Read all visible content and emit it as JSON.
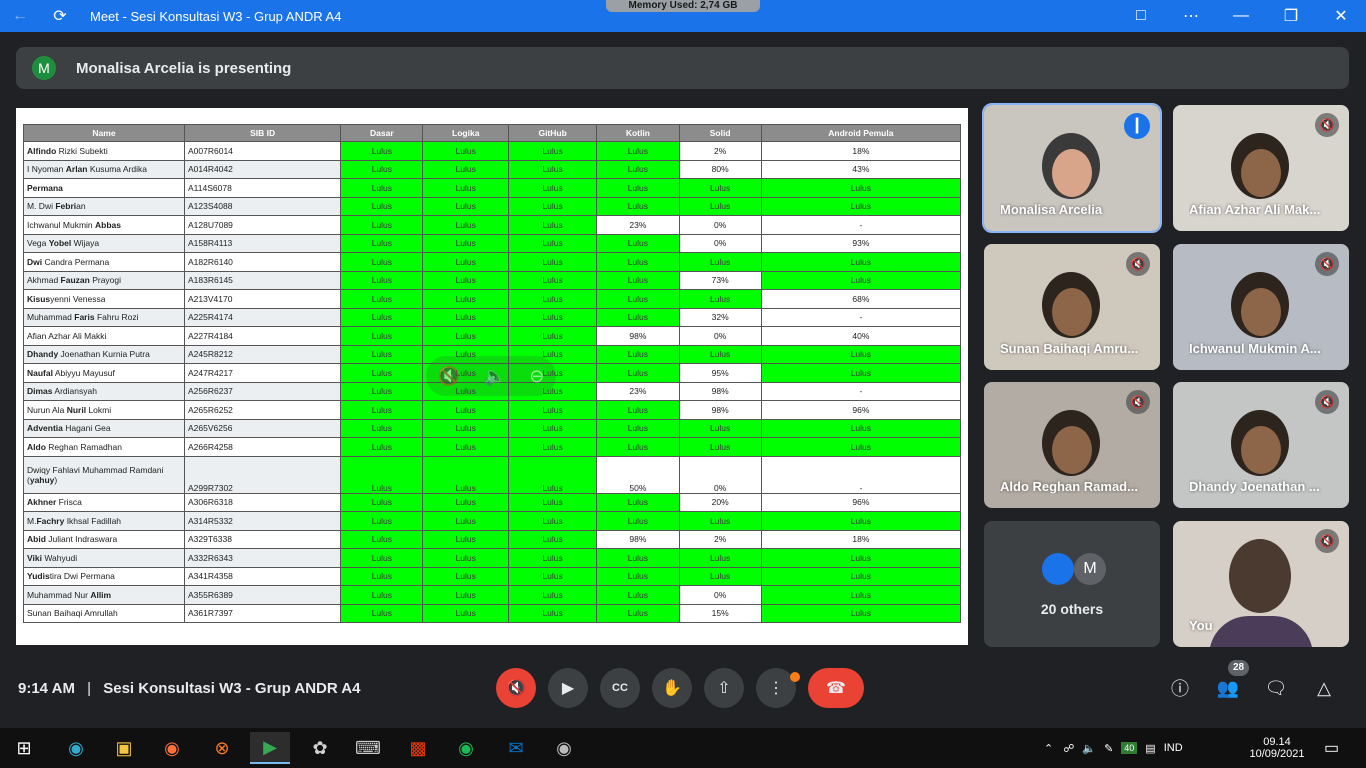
{
  "window": {
    "title": "Meet - Sesi Konsultasi W3 - Grup ANDR A4",
    "memory": "Memory Used: 2,74 GB"
  },
  "presenting": {
    "avatar_letter": "M",
    "text": "Monalisa Arcelia is presenting"
  },
  "table": {
    "headers": [
      "Name",
      "SIB ID",
      "Dasar",
      "Logika",
      "GitHub",
      "Kotlin",
      "Solid",
      "Android Pemula"
    ],
    "rows": [
      {
        "name_pre": "",
        "name_bold": "Alfindo",
        "name_post": " Rizki Subekti",
        "id": "A007R6014",
        "v": [
          "Lulus",
          "Lulus",
          "Lulus",
          "Lulus",
          "2%",
          "18%"
        ]
      },
      {
        "name_pre": "I Nyoman ",
        "name_bold": "Arlan",
        "name_post": " Kusuma Ardika",
        "id": "A014R4042",
        "v": [
          "Lulus",
          "Lulus",
          "Lulus",
          "Lulus",
          "80%",
          "43%"
        ]
      },
      {
        "name_pre": "",
        "name_bold": "Permana",
        "name_post": "",
        "id": "A114S6078",
        "v": [
          "Lulus",
          "Lulus",
          "Lulus",
          "Lulus",
          "Lulus",
          "Lulus"
        ]
      },
      {
        "name_pre": "M. Dwi ",
        "name_bold": "Febri",
        "name_post": "an",
        "id": "A123S4088",
        "v": [
          "Lulus",
          "Lulus",
          "Lulus",
          "Lulus",
          "Lulus",
          "Lulus"
        ]
      },
      {
        "name_pre": "Ichwanul Mukmin ",
        "name_bold": "Abbas",
        "name_post": "",
        "id": "A128U7089",
        "v": [
          "Lulus",
          "Lulus",
          "Lulus",
          "23%",
          "0%",
          "-"
        ]
      },
      {
        "name_pre": "Vega ",
        "name_bold": "Yobel",
        "name_post": " Wijaya",
        "id": "A158R4113",
        "v": [
          "Lulus",
          "Lulus",
          "Lulus",
          "Lulus",
          "0%",
          "93%"
        ]
      },
      {
        "name_pre": "",
        "name_bold": "Dwi",
        "name_post": " Candra Permana",
        "id": "A182R6140",
        "v": [
          "Lulus",
          "Lulus",
          "Lulus",
          "Lulus",
          "Lulus",
          "Lulus"
        ]
      },
      {
        "name_pre": "Akhmad ",
        "name_bold": "Fauzan",
        "name_post": " Prayogi",
        "id": "A183R6145",
        "v": [
          "Lulus",
          "Lulus",
          "Lulus",
          "Lulus",
          "73%",
          "Lulus"
        ]
      },
      {
        "name_pre": "",
        "name_bold": "Kisus",
        "name_post": "yenni Venessa",
        "id": "A213V4170",
        "v": [
          "Lulus",
          "Lulus",
          "Lulus",
          "Lulus",
          "Lulus",
          "68%"
        ]
      },
      {
        "name_pre": "Muhammad ",
        "name_bold": "Faris",
        "name_post": " Fahru Rozi",
        "id": "A225R4174",
        "v": [
          "Lulus",
          "Lulus",
          "Lulus",
          "Lulus",
          "32%",
          "-"
        ]
      },
      {
        "name_pre": "",
        "name_bold": "",
        "name_post": "Afian Azhar Ali Makki",
        "id": "A227R4184",
        "v": [
          "Lulus",
          "Lulus",
          "Lulus",
          "98%",
          "0%",
          "40%"
        ]
      },
      {
        "name_pre": "",
        "name_bold": "Dhandy",
        "name_post": " Joenathan Kurnia Putra",
        "id": "A245R8212",
        "v": [
          "Lulus",
          "Lulus",
          "Lulus",
          "Lulus",
          "Lulus",
          "Lulus"
        ]
      },
      {
        "name_pre": "",
        "name_bold": "Naufal",
        "name_post": " Abiyyu Mayusuf",
        "id": "A247R4217",
        "v": [
          "Lulus",
          "Lulus",
          "Lulus",
          "Lulus",
          "95%",
          "Lulus"
        ]
      },
      {
        "name_pre": "",
        "name_bold": "Dimas",
        "name_post": " Ardiansyah",
        "id": "A256R6237",
        "v": [
          "Lulus",
          "Lulus",
          "Lulus",
          "23%",
          "98%",
          "-"
        ]
      },
      {
        "name_pre": "Nurun Ala ",
        "name_bold": "Nuril",
        "name_post": " Lokmi",
        "id": "A265R6252",
        "v": [
          "Lulus",
          "Lulus",
          "Lulus",
          "Lulus",
          "98%",
          "96%"
        ]
      },
      {
        "name_pre": "",
        "name_bold": "Adventia",
        "name_post": " Hagani Gea",
        "id": "A265V6256",
        "v": [
          "Lulus",
          "Lulus",
          "Lulus",
          "Lulus",
          "Lulus",
          "Lulus"
        ]
      },
      {
        "name_pre": "",
        "name_bold": "Aldo",
        "name_post": " Reghan Ramadhan",
        "id": "A266R4258",
        "v": [
          "Lulus",
          "Lulus",
          "Lulus",
          "Lulus",
          "Lulus",
          "Lulus"
        ]
      },
      {
        "name_pre": "Dwiqy Fahlavi Muhammad Ramdani (",
        "name_bold": "yahuy",
        "name_post": ")",
        "id": "A299R7302",
        "v": [
          "Lulus",
          "Lulus",
          "Lulus",
          "50%",
          "0%",
          "-"
        ],
        "tall": true
      },
      {
        "name_pre": "",
        "name_bold": "Akhner",
        "name_post": " Frisca",
        "id": "A306R6318",
        "v": [
          "Lulus",
          "Lulus",
          "Lulus",
          "Lulus",
          "20%",
          "96%"
        ]
      },
      {
        "name_pre": "M.",
        "name_bold": "Fachry",
        "name_post": " Ikhsal Fadillah",
        "id": "A314R5332",
        "v": [
          "Lulus",
          "Lulus",
          "Lulus",
          "Lulus",
          "Lulus",
          "Lulus"
        ]
      },
      {
        "name_pre": "",
        "name_bold": "Abid",
        "name_post": " Juliant Indraswara",
        "id": "A329T6338",
        "v": [
          "Lulus",
          "Lulus",
          "Lulus",
          "98%",
          "2%",
          "18%"
        ]
      },
      {
        "name_pre": "",
        "name_bold": "Viki",
        "name_post": " Wahyudi",
        "id": "A332R6343",
        "v": [
          "Lulus",
          "Lulus",
          "Lulus",
          "Lulus",
          "Lulus",
          "Lulus"
        ]
      },
      {
        "name_pre": "",
        "name_bold": "Yudis",
        "name_post": "tira Dwi Permana",
        "id": "A341R4358",
        "v": [
          "Lulus",
          "Lulus",
          "Lulus",
          "Lulus",
          "Lulus",
          "Lulus"
        ]
      },
      {
        "name_pre": "Muhammad Nur ",
        "name_bold": "Allim",
        "name_post": "",
        "id": "A355R6389",
        "v": [
          "Lulus",
          "Lulus",
          "Lulus",
          "Lulus",
          "0%",
          "Lulus"
        ]
      },
      {
        "name_pre": "Sunan Baihaqi Amrullah",
        "name_bold": "",
        "name_post": "",
        "id": "A361R7397",
        "v": [
          "Lulus",
          "Lulus",
          "Lulus",
          "Lulus",
          "15%",
          "Lulus"
        ]
      }
    ]
  },
  "participants": [
    {
      "name": "Monalisa Arcelia",
      "speaking": true,
      "color": "#c9c5bf"
    },
    {
      "name": "Afian Azhar Ali Mak...",
      "speaking": false,
      "color": "#d8d4ce"
    },
    {
      "name": "Sunan Baihaqi Amru...",
      "speaking": false,
      "color": "#cfc8bd"
    },
    {
      "name": "Ichwanul Mukmin A...",
      "speaking": false,
      "color": "#b7bcc4"
    },
    {
      "name": "Aldo Reghan Ramad...",
      "speaking": false,
      "color": "#b3aca4"
    },
    {
      "name": "Dhandy Joenathan ...",
      "speaking": false,
      "color": "#c4c6c6"
    }
  ],
  "others": {
    "avatar_letter": "M",
    "label": "20 others"
  },
  "self": {
    "name": "You",
    "color": "#d6cfc7"
  },
  "controls": {
    "time": "9:14 AM",
    "separator": "|",
    "meeting": "Sesi Konsultasi W3 - Grup ANDR A4",
    "people_count": "28"
  },
  "taskbar": {
    "lang": "IND",
    "time": "09.14",
    "date": "10/09/2021",
    "battery": "40"
  }
}
